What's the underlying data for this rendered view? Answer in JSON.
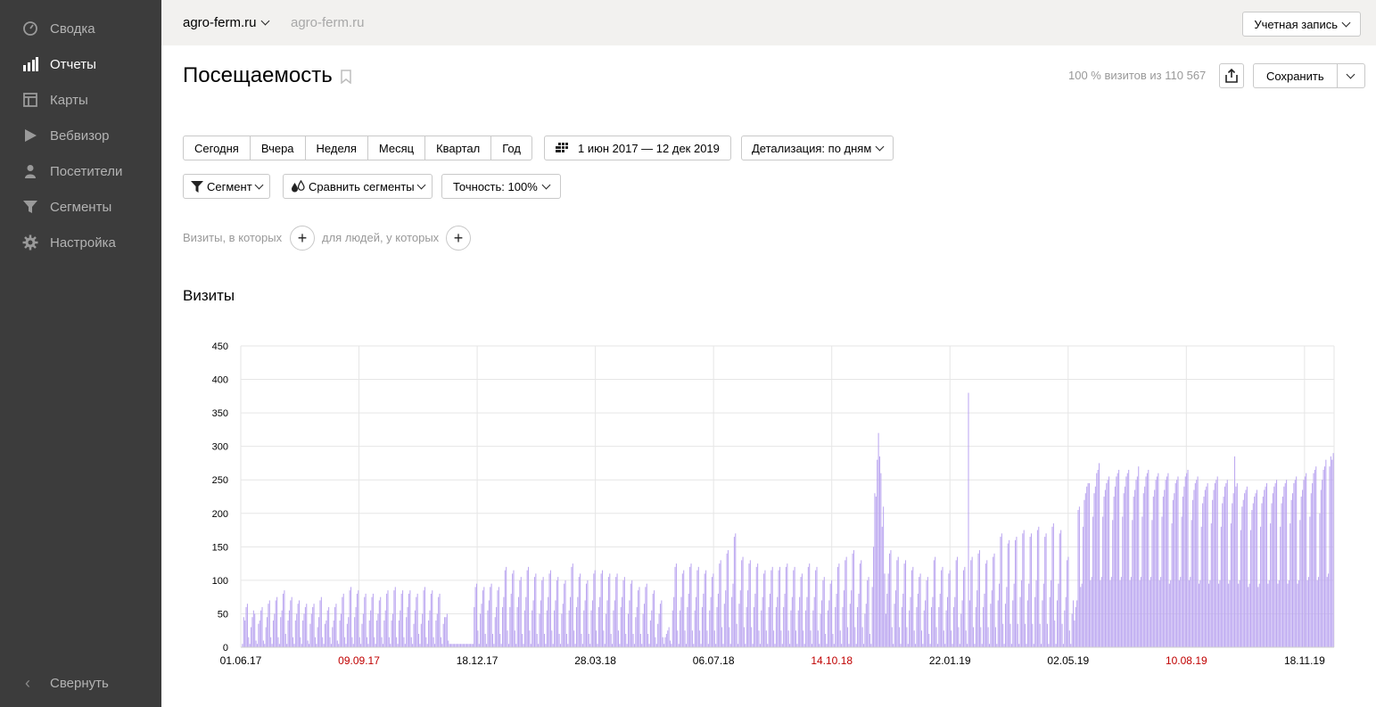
{
  "sidebar": {
    "items": [
      {
        "label": "Сводка",
        "icon": "speedometer-icon",
        "active": false
      },
      {
        "label": "Отчеты",
        "icon": "bar-chart-icon",
        "active": true
      },
      {
        "label": "Карты",
        "icon": "map-layout-icon",
        "active": false
      },
      {
        "label": "Вебвизор",
        "icon": "play-icon",
        "active": false
      },
      {
        "label": "Посетители",
        "icon": "person-icon",
        "active": false
      },
      {
        "label": "Сегменты",
        "icon": "funnel-icon",
        "active": false
      },
      {
        "label": "Настройка",
        "icon": "gear-icon",
        "active": false
      }
    ],
    "collapse_label": "Свернуть"
  },
  "topbar": {
    "site": "agro-ferm.ru",
    "site_ghost": "agro-ferm.ru",
    "account_label": "Учетная запись"
  },
  "header": {
    "title": "Посещаемость",
    "visits_info": "100 % визитов из 110 567",
    "save_label": "Сохранить"
  },
  "periods": [
    "Сегодня",
    "Вчера",
    "Неделя",
    "Месяц",
    "Квартал",
    "Год"
  ],
  "date_range": "1 июн 2017 — 12 дек 2019",
  "detail_label": "Детализация: по дням",
  "segment_label": "Сегмент",
  "compare_label": "Сравнить сегменты",
  "accuracy_label": "Точность: 100%",
  "filters": {
    "visits_label": "Визиты, в которых",
    "people_label": "для людей, у которых"
  },
  "colors": {
    "bar": "#bba6f0",
    "weekend_label": "#c00000",
    "sidebar": "#3c3c3c"
  },
  "chart_data": {
    "type": "bar",
    "title": "Визиты",
    "ylim": [
      0,
      450
    ],
    "yticks": [
      0,
      50,
      100,
      150,
      200,
      250,
      300,
      350,
      400,
      450
    ],
    "x_start": "2017-06-01",
    "x_end": "2019-12-12",
    "xticks": [
      {
        "label": "01.06.17",
        "weekend": false
      },
      {
        "label": "09.09.17",
        "weekend": true
      },
      {
        "label": "18.12.17",
        "weekend": false
      },
      {
        "label": "28.03.18",
        "weekend": false
      },
      {
        "label": "06.07.18",
        "weekend": false
      },
      {
        "label": "14.10.18",
        "weekend": true
      },
      {
        "label": "22.01.19",
        "weekend": false
      },
      {
        "label": "02.05.19",
        "weekend": false
      },
      {
        "label": "10.08.19",
        "weekend": true
      },
      {
        "label": "18.11.19",
        "weekend": false
      }
    ],
    "series": [
      {
        "values": [
          0,
          5,
          45,
          40,
          60,
          65,
          15,
          5,
          30,
          45,
          55,
          50,
          10,
          5,
          35,
          40,
          55,
          60,
          10,
          5,
          30,
          45,
          65,
          70,
          15,
          5,
          40,
          50,
          70,
          75,
          15,
          5,
          45,
          55,
          80,
          85,
          20,
          5,
          40,
          55,
          70,
          75,
          15,
          5,
          40,
          50,
          65,
          70,
          15,
          5,
          40,
          50,
          60,
          65,
          10,
          5,
          35,
          50,
          60,
          65,
          15,
          5,
          30,
          45,
          70,
          75,
          15,
          5,
          35,
          40,
          55,
          60,
          15,
          5,
          30,
          40,
          60,
          65,
          10,
          5,
          40,
          50,
          75,
          80,
          15,
          5,
          35,
          45,
          85,
          90,
          15,
          5,
          45,
          60,
          80,
          85,
          15,
          5,
          35,
          50,
          75,
          80,
          15,
          5,
          40,
          55,
          75,
          80,
          15,
          5,
          40,
          50,
          70,
          75,
          15,
          5,
          40,
          55,
          80,
          85,
          15,
          5,
          40,
          50,
          85,
          90,
          15,
          5,
          40,
          55,
          80,
          85,
          15,
          5,
          45,
          60,
          80,
          85,
          15,
          5,
          35,
          55,
          75,
          80,
          20,
          5,
          35,
          50,
          85,
          90,
          15,
          5,
          40,
          55,
          80,
          85,
          15,
          5,
          40,
          50,
          75,
          80,
          15,
          5,
          35,
          45,
          45,
          50,
          10,
          5,
          5,
          5,
          5,
          5,
          5,
          5,
          5,
          5,
          5,
          5,
          5,
          5,
          5,
          5,
          5,
          5,
          5,
          5,
          5,
          60,
          90,
          95,
          25,
          5,
          50,
          65,
          85,
          90,
          20,
          5,
          55,
          70,
          90,
          95,
          20,
          5,
          45,
          60,
          85,
          90,
          20,
          5,
          60,
          75,
          115,
          120,
          25,
          5,
          60,
          80,
          110,
          115,
          25,
          5,
          60,
          75,
          100,
          105,
          20,
          5,
          55,
          75,
          115,
          120,
          25,
          5,
          55,
          70,
          105,
          110,
          20,
          5,
          50,
          70,
          100,
          105,
          20,
          5,
          55,
          75,
          110,
          115,
          25,
          5,
          55,
          70,
          100,
          105,
          20,
          5,
          50,
          65,
          95,
          100,
          20,
          5,
          55,
          75,
          120,
          125,
          25,
          5,
          60,
          75,
          105,
          110,
          20,
          5,
          55,
          70,
          95,
          100,
          20,
          5,
          55,
          70,
          110,
          115,
          25,
          5,
          60,
          75,
          110,
          115,
          25,
          5,
          50,
          70,
          105,
          110,
          20,
          5,
          55,
          70,
          105,
          110,
          25,
          5,
          60,
          75,
          100,
          105,
          20,
          5,
          50,
          70,
          95,
          100,
          20,
          5,
          45,
          60,
          85,
          90,
          20,
          5,
          50,
          65,
          90,
          95,
          20,
          5,
          40,
          55,
          80,
          85,
          15,
          5,
          35,
          50,
          65,
          70,
          15,
          5,
          15,
          20,
          25,
          30,
          10,
          5,
          55,
          75,
          120,
          125,
          25,
          5,
          55,
          75,
          110,
          115,
          25,
          5,
          60,
          80,
          120,
          125,
          25,
          5,
          55,
          75,
          115,
          120,
          25,
          5,
          60,
          80,
          110,
          115,
          25,
          5,
          55,
          75,
          105,
          110,
          25,
          5,
          60,
          80,
          125,
          130,
          30,
          5,
          65,
          85,
          140,
          145,
          30,
          5,
          75,
          95,
          165,
          170,
          35,
          5,
          65,
          85,
          130,
          135,
          30,
          5,
          60,
          85,
          125,
          130,
          30,
          5,
          60,
          80,
          120,
          125,
          25,
          5,
          55,
          75,
          110,
          115,
          25,
          5,
          60,
          80,
          115,
          120,
          25,
          5,
          60,
          75,
          115,
          120,
          25,
          5,
          60,
          80,
          120,
          125,
          25,
          5,
          55,
          75,
          115,
          120,
          25,
          5,
          55,
          75,
          105,
          110,
          25,
          5,
          55,
          75,
          120,
          125,
          25,
          5,
          55,
          75,
          115,
          120,
          25,
          5,
          50,
          70,
          100,
          105,
          20,
          5,
          55,
          70,
          95,
          100,
          20,
          5,
          60,
          80,
          120,
          125,
          25,
          5,
          60,
          85,
          130,
          135,
          30,
          5,
          65,
          85,
          140,
          145,
          30,
          5,
          60,
          80,
          125,
          130,
          30,
          5,
          50,
          65,
          100,
          105,
          20,
          5,
          90,
          150,
          230,
          225,
          280,
          320,
          285,
          260,
          180,
          210,
          110,
          50,
          80,
          110,
          140,
          145,
          30,
          5,
          65,
          85,
          130,
          135,
          30,
          5,
          60,
          80,
          125,
          130,
          30,
          5,
          55,
          75,
          115,
          120,
          25,
          5,
          60,
          80,
          105,
          110,
          25,
          5,
          55,
          70,
          100,
          105,
          20,
          5,
          60,
          75,
          130,
          135,
          30,
          5,
          60,
          80,
          115,
          120,
          25,
          5,
          55,
          75,
          110,
          115,
          25,
          5,
          60,
          75,
          130,
          135,
          30,
          5,
          50,
          70,
          115,
          120,
          25,
          5,
          380,
          70,
          130,
          135,
          30,
          5,
          60,
          85,
          140,
          145,
          30,
          5,
          60,
          80,
          125,
          130,
          30,
          5,
          65,
          85,
          135,
          140,
          30,
          5,
          70,
          95,
          165,
          170,
          35,
          5,
          65,
          90,
          155,
          160,
          35,
          5,
          70,
          95,
          160,
          165,
          35,
          5,
          75,
          100,
          170,
          175,
          35,
          5,
          70,
          95,
          165,
          170,
          35,
          5,
          75,
          100,
          175,
          180,
          35,
          5,
          70,
          95,
          165,
          170,
          35,
          5,
          75,
          100,
          180,
          185,
          40,
          5,
          70,
          95,
          170,
          175,
          35,
          5,
          55,
          75,
          130,
          135,
          25,
          5,
          50,
          70,
          40,
          60,
          70,
          205,
          210,
          90,
          95,
          180,
          220,
          230,
          240,
          245,
          245,
          100,
          105,
          195,
          230,
          240,
          260,
          265,
          275,
          100,
          105,
          195,
          225,
          235,
          245,
          250,
          255,
          100,
          105,
          190,
          225,
          240,
          255,
          260,
          265,
          100,
          105,
          195,
          230,
          240,
          255,
          260,
          265,
          100,
          105,
          190,
          225,
          235,
          250,
          255,
          270,
          100,
          105,
          195,
          230,
          240,
          255,
          260,
          265,
          100,
          105,
          190,
          225,
          235,
          250,
          255,
          260,
          100,
          105,
          195,
          225,
          235,
          250,
          255,
          260,
          95,
          100,
          185,
          220,
          230,
          245,
          250,
          255,
          100,
          105,
          195,
          225,
          240,
          255,
          260,
          265,
          100,
          105,
          190,
          220,
          235,
          245,
          250,
          255,
          95,
          100,
          180,
          215,
          225,
          235,
          240,
          245,
          95,
          100,
          185,
          220,
          235,
          245,
          250,
          255,
          95,
          100,
          180,
          215,
          225,
          240,
          245,
          250,
          95,
          100,
          185,
          215,
          230,
          285,
          240,
          245,
          95,
          100,
          175,
          210,
          220,
          230,
          235,
          240,
          90,
          95,
          175,
          205,
          215,
          225,
          230,
          235,
          90,
          95,
          180,
          215,
          225,
          235,
          240,
          245,
          95,
          100,
          185,
          215,
          230,
          240,
          245,
          250,
          95,
          100,
          180,
          215,
          225,
          240,
          245,
          250,
          95,
          100,
          185,
          220,
          230,
          245,
          250,
          255,
          95,
          100,
          190,
          225,
          235,
          250,
          255,
          260,
          100,
          105,
          195,
          230,
          245,
          260,
          265,
          270,
          100,
          105,
          200,
          235,
          250,
          265,
          270,
          280,
          105,
          110,
          270,
          285,
          280,
          290
        ]
      }
    ]
  }
}
